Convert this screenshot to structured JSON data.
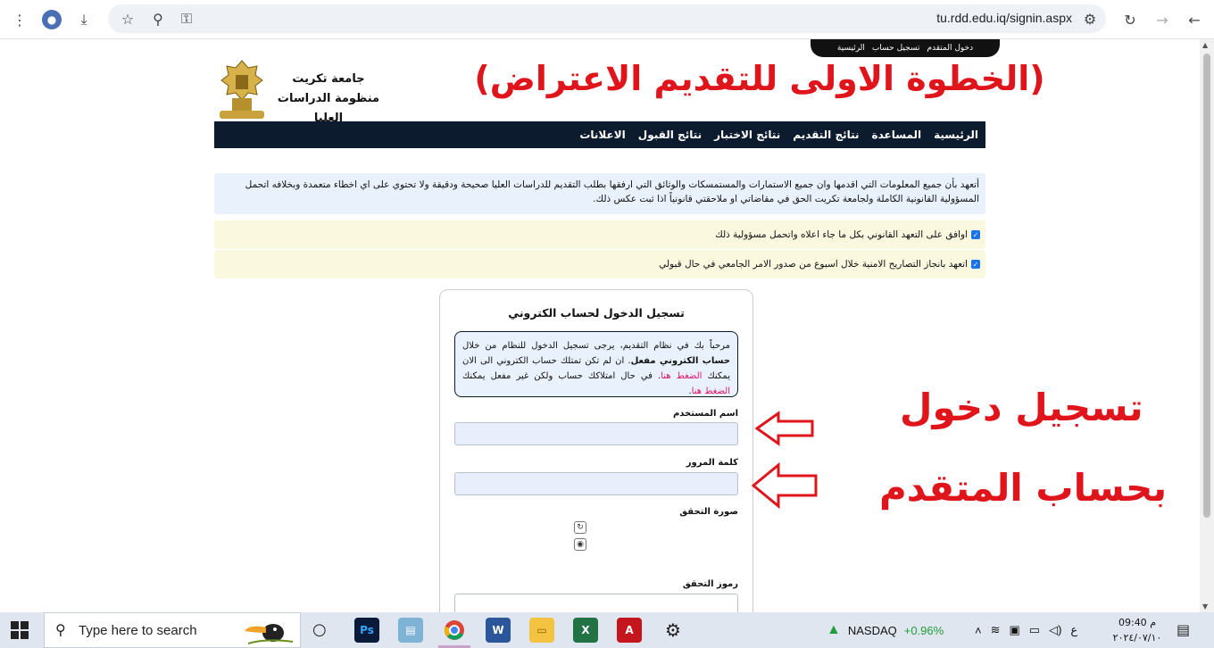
{
  "browser": {
    "url": "tu.rdd.edu.iq/signin.aspx"
  },
  "site": {
    "topbar_links": [
      "دخول المتقدم",
      "تسجيل حساب",
      "الرئيسية"
    ],
    "uni_line1": "جامعة تكريت",
    "uni_line2": "منظومة الدراسات العليا",
    "overlay_title": "(الخطوة الاولى للتقديم الاعتراض)",
    "nav": [
      "الرئيسية",
      "المساعدة",
      "نتائج التقديم",
      "نتائج الاختبار",
      "نتائج القبول",
      "الاعلانات"
    ],
    "notice": "أتعهد بأن جميع المعلومات التي اقدمها وان جميع الاستمارات والمستمسكات والوثائق التي ارفقها بطلب التقديم للدراسات العليا صحيحة ودقيقة ولا تحتوي على اي اخطاء متعمدة وبخلافه اتحمل المسؤولية القانونية الكاملة ولجامعة تكريت الحق في مقاضاتي او ملاحقتي قانونياً اذا ثبت عكس ذلك.",
    "agree1": "اوافق على التعهد القانوني بكل ما جاء اعلاه واتحمل مسؤولية ذلك",
    "agree2": "اتعهد بانجاز التصاريح الامنية خلال اسبوع من صدور الامر الجامعي في حال قبولي"
  },
  "login": {
    "title": "تسجيل الدخول لحساب الكتروني",
    "welcome_a": "مرحباً بك في نظام التقديم، يرجى تسجيل الدخول للنظام من خلال",
    "welcome_bold": "حساب الكتروني مفعل",
    "welcome_b": ". ان لم تكن تمتلك حساب الكتروني الى الان يمكنك",
    "link1": "الضغط هنا",
    "welcome_c": "في حال امتلاكك حساب ولكن غير مفعل يمكنك",
    "link2": "الضغط هنا",
    "username_label": "اسم المستخدم",
    "password_label": "كلمة المرور",
    "captcha_label": "صورة التحقق",
    "code_label": "رموز التحقق"
  },
  "annotations": {
    "line1": "تسجيل دخول",
    "line2": "بحساب المتقدم",
    "color": "#e0141b"
  },
  "taskbar": {
    "search_placeholder": "Type here to search",
    "stock_name": "NASDAQ",
    "stock_change": "+0.96%",
    "lang": "ع",
    "time": "09:40 م",
    "date": "٢٠٢٤/٠٧/١٠"
  }
}
